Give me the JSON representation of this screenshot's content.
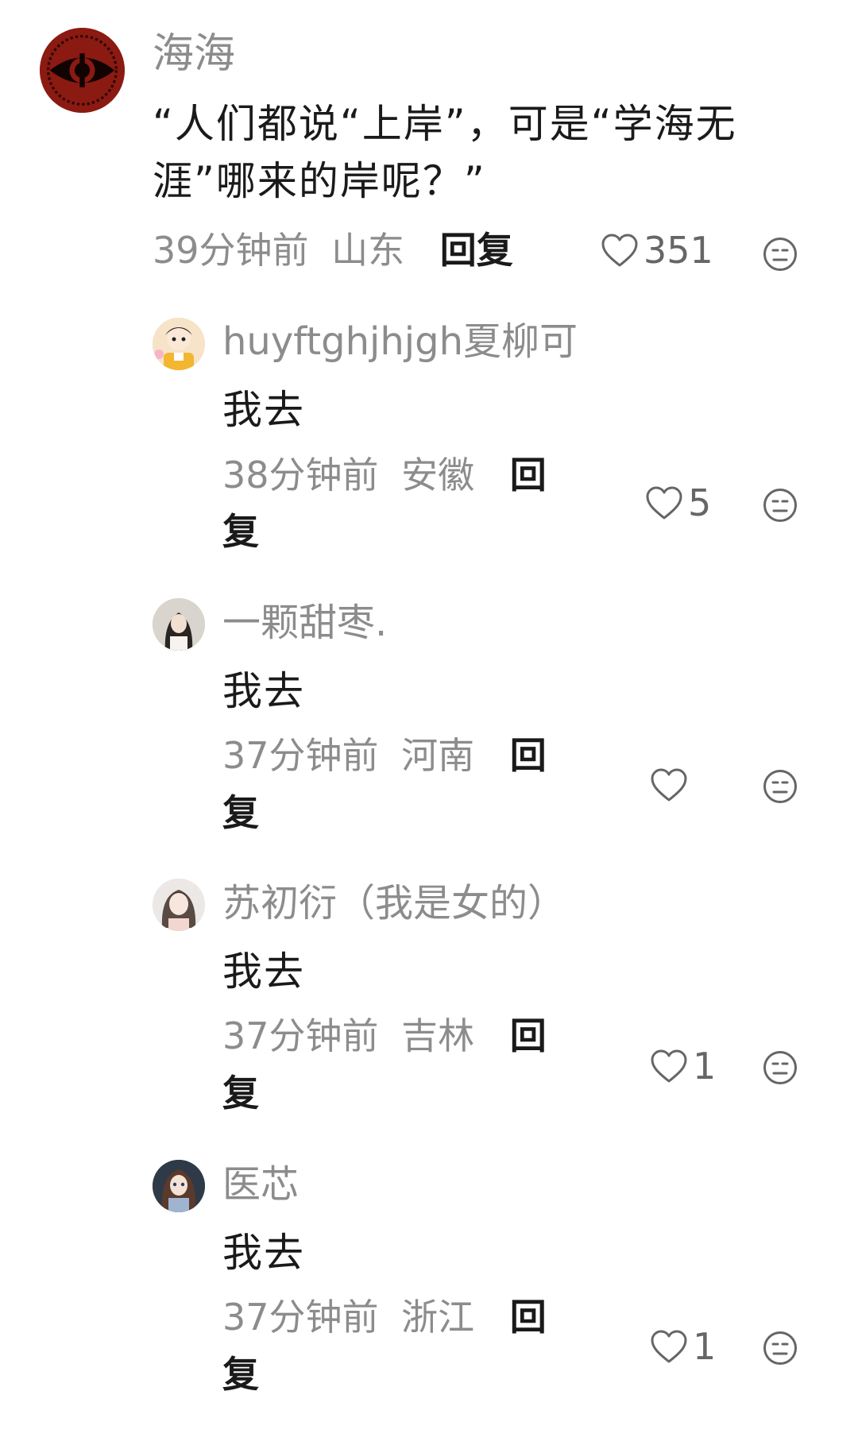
{
  "main_comment": {
    "username": "海海",
    "text": "“人们都说“上岸”，可是“学海无涯”哪来的岸呢？”",
    "time": "39分钟前",
    "location": "山东",
    "reply_label": "回复",
    "likes": "351",
    "avatar_icon": "eye-logo-avatar"
  },
  "replies": [
    {
      "username": "huyftghjhjgh夏柳可",
      "text": "我去",
      "time": "38分钟前",
      "location": "安徽",
      "reply_label_1": "回",
      "reply_label_2": "复",
      "likes": "5"
    },
    {
      "username": "一颗甜枣.",
      "text": "我去",
      "time": "37分钟前",
      "location": "河南",
      "reply_label_1": "回",
      "reply_label_2": "复",
      "likes": ""
    },
    {
      "username": "苏初衍（我是女的）",
      "text": "我去",
      "time": "37分钟前",
      "location": "吉林",
      "reply_label_1": "回",
      "reply_label_2": "复",
      "likes": "1"
    },
    {
      "username": "医芯",
      "text": "我去",
      "time": "37分钟前",
      "location": "浙江",
      "reply_label_1": "回",
      "reply_label_2": "复",
      "likes": "1"
    }
  ],
  "colors": {
    "secondary_text": "#8c8c8c",
    "primary_text": "#1a1a1a",
    "icon": "#666666"
  }
}
